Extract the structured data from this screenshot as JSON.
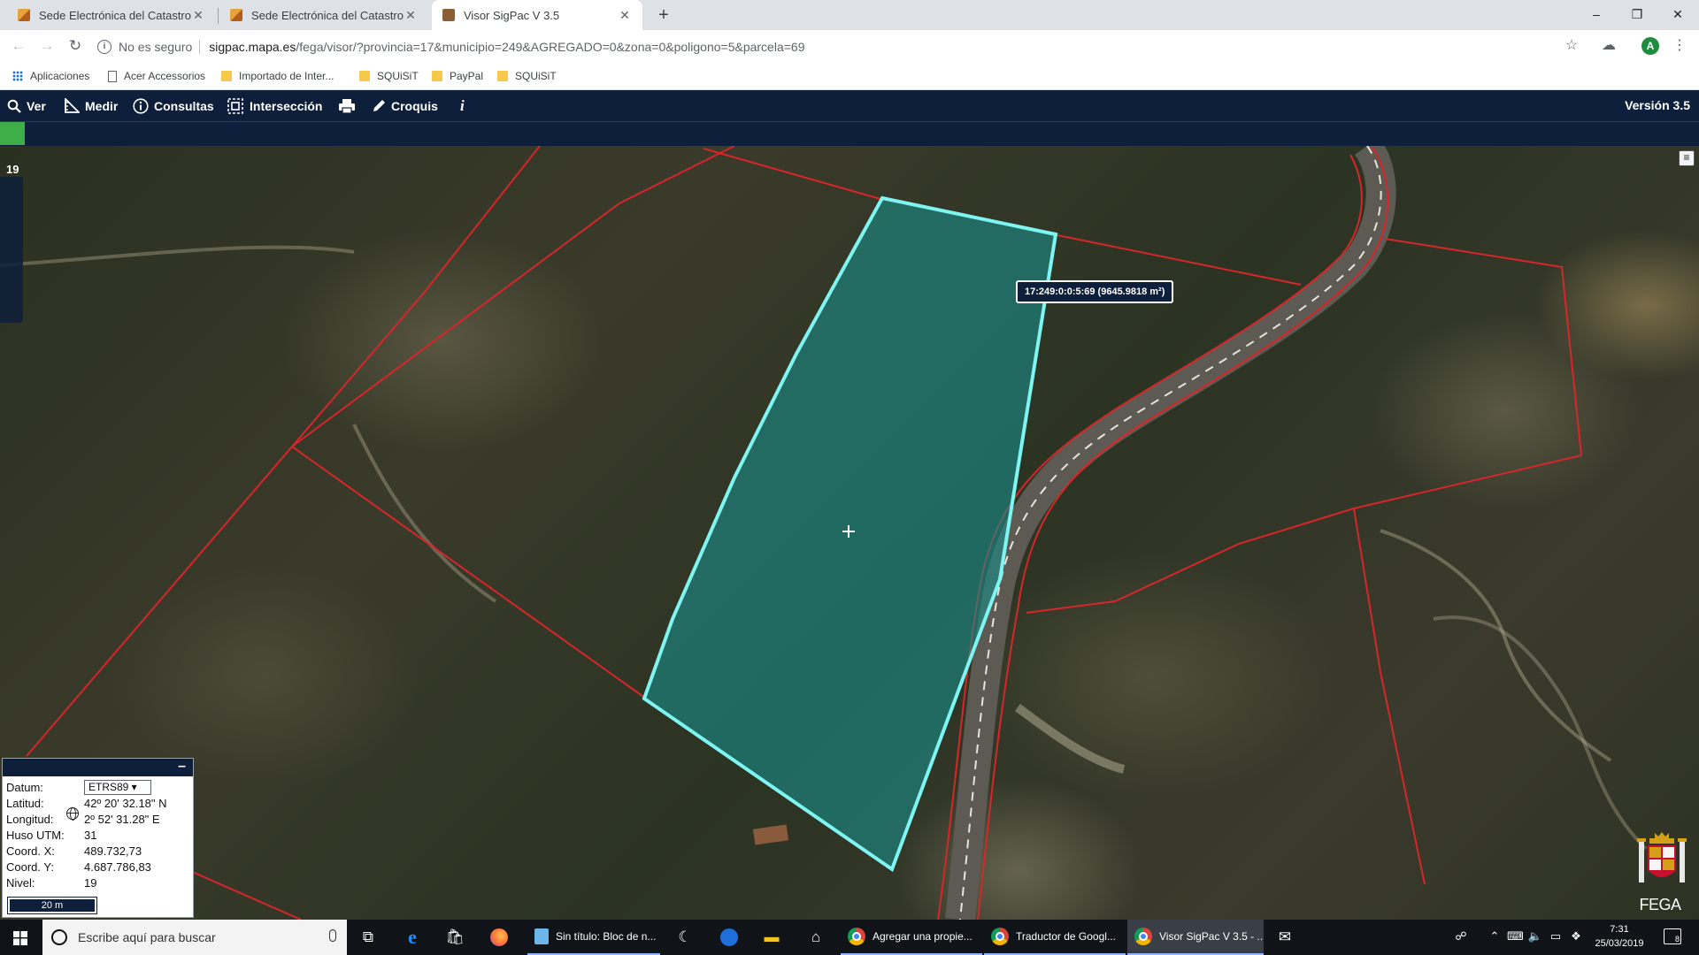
{
  "browser": {
    "tabs": [
      {
        "title": "Sede Electrónica del Catastro",
        "active": false
      },
      {
        "title": "Sede Electrónica del Catastro",
        "active": false
      },
      {
        "title": "Visor SigPac V 3.5",
        "active": true
      }
    ],
    "address": {
      "security_label": "No es seguro",
      "url_host": "sigpac.mapa.es",
      "url_rest": "/fega/visor/?provincia=17&municipio=249&AGREGADO=0&zona=0&poligono=5&parcela=69"
    },
    "profile_initial": "A",
    "bookmarks": [
      {
        "label": "Aplicaciones",
        "icon": "apps-icon"
      },
      {
        "label": "Acer Accessorios",
        "icon": "page-icon"
      },
      {
        "label": "Importado de Inter...",
        "icon": "folder-icon"
      },
      {
        "label": "SQUiSiT",
        "icon": "folder-icon"
      },
      {
        "label": "PayPal",
        "icon": "folder-icon"
      },
      {
        "label": "SQUiSiT",
        "icon": "folder-icon"
      }
    ]
  },
  "app": {
    "menu": [
      {
        "label": "Ver",
        "icon": "search-icon"
      },
      {
        "label": "Medir",
        "icon": "ruler-icon"
      },
      {
        "label": "Consultas",
        "icon": "info-circle-icon"
      },
      {
        "label": "Intersección",
        "icon": "intersection-icon"
      },
      {
        "label": "",
        "icon": "print-icon"
      },
      {
        "label": "Croquis",
        "icon": "pencil-icon"
      },
      {
        "label": "",
        "icon": "info-icon"
      }
    ],
    "version": "Versión 3.5",
    "accent_color": "#0d1f3a"
  },
  "map": {
    "zoom_level": "19",
    "parcel_label": "17:249:0:0:5:69 (9645.9818 m²)",
    "parcel_fill_color": "#1a8a88",
    "parcel_outline_color": "#7ff5f2",
    "boundary_color": "#d6262a"
  },
  "coords": {
    "datum_label": "Datum:",
    "datum_value": "ETRS89 ▾",
    "lat_label": "Latitud:",
    "lat_value": "42º 20' 32.18\" N",
    "lon_label": "Longitud:",
    "lon_value": "2º 52' 31.28\" E",
    "huso_label": "Huso UTM:",
    "huso_value": "31",
    "x_label": "Coord. X:",
    "x_value": "489.732,73",
    "y_label": "Coord. Y:",
    "y_value": "4.687.786,83",
    "nivel_label": "Nivel:",
    "nivel_value": "19",
    "scale_label": "20 m"
  },
  "logo": {
    "text": "FEGA"
  },
  "taskbar": {
    "search_placeholder": "Escribe aquí para buscar",
    "apps": [
      {
        "label": "Sin título: Bloc de n...",
        "icon": "notepad-icon"
      },
      {
        "label": "Agregar una propie...",
        "icon": "chrome-icon"
      },
      {
        "label": "Traductor de Googl...",
        "icon": "chrome-icon"
      },
      {
        "label": "Visor SigPac V 3.5 - ...",
        "icon": "chrome-icon"
      }
    ],
    "time": "7:31",
    "date": "25/03/2019",
    "notification_count": "8"
  }
}
